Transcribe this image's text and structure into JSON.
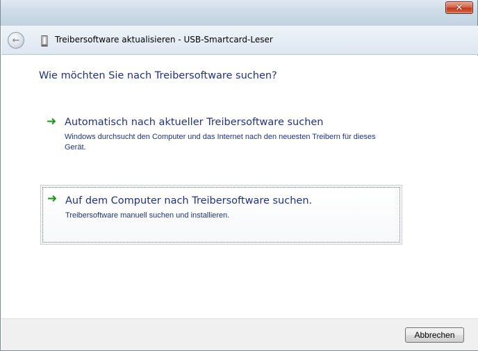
{
  "window": {
    "title": "Treibersoftware aktualisieren - USB-Smartcard-Leser",
    "close_glyph": "✕"
  },
  "navbar": {
    "back_icon": "back-arrow-icon",
    "device_icon": "usb-device-icon"
  },
  "content": {
    "heading": "Wie möchten Sie nach Treibersoftware suchen?",
    "options": [
      {
        "title": "Automatisch nach aktueller Treibersoftware suchen",
        "description": "Windows durchsucht den Computer und das Internet nach den neuesten Treibern für dieses Gerät.",
        "icon": "green-arrow-icon"
      },
      {
        "title": "Auf dem Computer nach Treibersoftware suchen.",
        "description": "Treibersoftware manuell suchen und installieren.",
        "icon": "green-arrow-icon"
      }
    ]
  },
  "footer": {
    "cancel_label": "Abbrechen"
  },
  "colors": {
    "link_text": "#1e3287",
    "arrow_green": "#1b9a1b",
    "close_red": "#c2391c"
  }
}
